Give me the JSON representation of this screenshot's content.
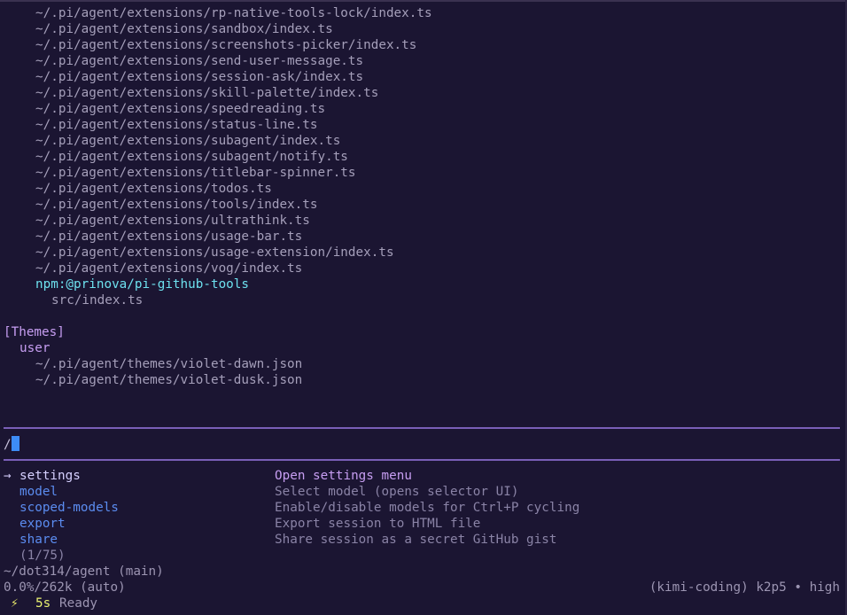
{
  "extensions_list": [
    "~/.pi/agent/extensions/rp-native-tools-lock/index.ts",
    "~/.pi/agent/extensions/sandbox/index.ts",
    "~/.pi/agent/extensions/screenshots-picker/index.ts",
    "~/.pi/agent/extensions/send-user-message.ts",
    "~/.pi/agent/extensions/session-ask/index.ts",
    "~/.pi/agent/extensions/skill-palette/index.ts",
    "~/.pi/agent/extensions/speedreading.ts",
    "~/.pi/agent/extensions/status-line.ts",
    "~/.pi/agent/extensions/subagent/index.ts",
    "~/.pi/agent/extensions/subagent/notify.ts",
    "~/.pi/agent/extensions/titlebar-spinner.ts",
    "~/.pi/agent/extensions/todos.ts",
    "~/.pi/agent/extensions/tools/index.ts",
    "~/.pi/agent/extensions/ultrathink.ts",
    "~/.pi/agent/extensions/usage-bar.ts",
    "~/.pi/agent/extensions/usage-extension/index.ts",
    "~/.pi/agent/extensions/vog/index.ts"
  ],
  "npm_package": {
    "name": "npm:@prinova/pi-github-tools",
    "file": "src/index.ts"
  },
  "themes": {
    "header": "[Themes]",
    "scope": "user",
    "files": [
      "~/.pi/agent/themes/violet-dawn.json",
      "~/.pi/agent/themes/violet-dusk.json"
    ]
  },
  "input": {
    "value": "/"
  },
  "commands": {
    "arrow": "→",
    "items": [
      {
        "name": "settings",
        "description": "Open settings menu"
      },
      {
        "name": "model",
        "description": "Select model (opens selector UI)"
      },
      {
        "name": "scoped-models",
        "description": "Enable/disable models for Ctrl+P cycling"
      },
      {
        "name": "export",
        "description": "Export session to HTML file"
      },
      {
        "name": "share",
        "description": "Share session as a secret GitHub gist"
      }
    ],
    "count": "(1/75)"
  },
  "status": {
    "cwd": "~/dot314/agent (main)",
    "context": "0.0%/262k (auto)",
    "model": "(kimi-coding) k2p5 • high",
    "bolt": "⚡",
    "time": "5s",
    "state": "Ready"
  },
  "colors": {
    "background": "#1b1532",
    "separator": "#7a5fb8",
    "accent_purple": "#c79ef2",
    "accent_cyan": "#6de0ee",
    "command_blue": "#5b8cf0",
    "cursor_blue": "#3d8cf5"
  }
}
